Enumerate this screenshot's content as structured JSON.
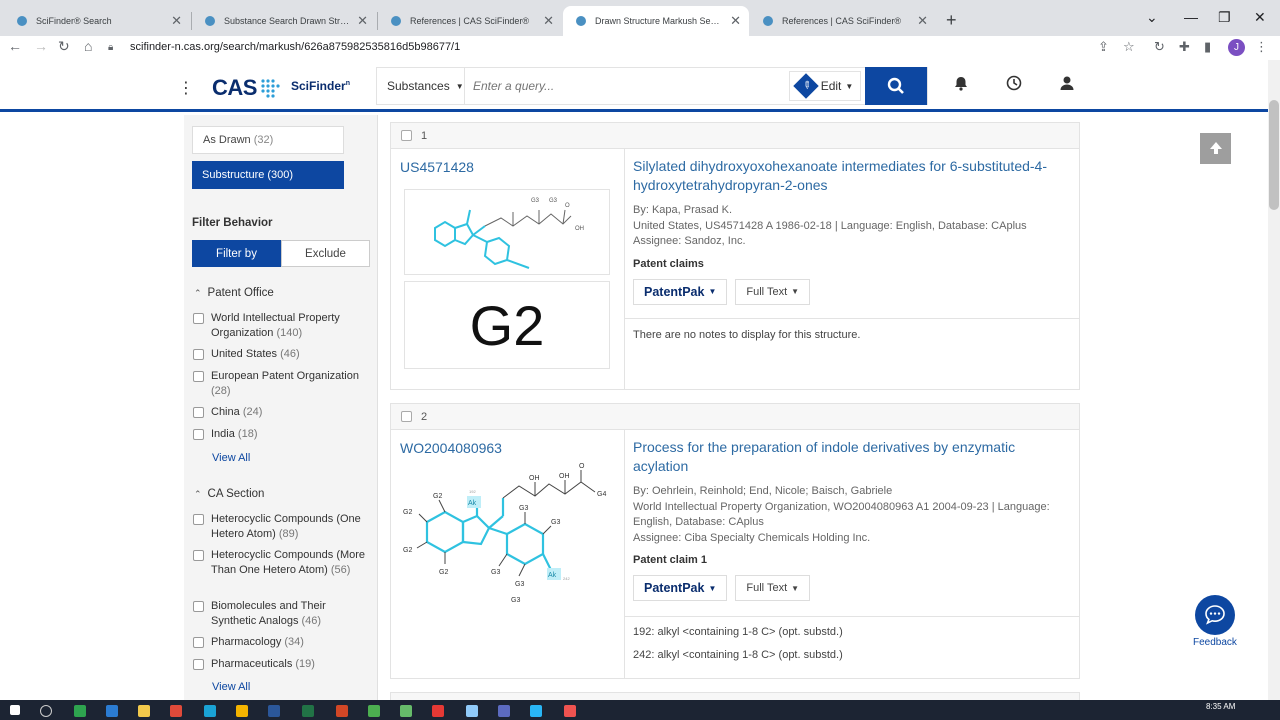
{
  "browser": {
    "tabs": [
      {
        "title": "SciFinder® Search",
        "active": false
      },
      {
        "title": "Substance Search Drawn Structure | CAS",
        "active": false
      },
      {
        "title": "References | CAS SciFinder®",
        "active": false
      },
      {
        "title": "Drawn Structure Markush Search | CAS",
        "active": true
      },
      {
        "title": "References | CAS SciFinder®",
        "active": false
      }
    ],
    "url": "scifinder-n.cas.org/search/markush/626a875982535816d5b98677/1",
    "profile_initial": "J"
  },
  "header": {
    "logo_text": "CAS",
    "product": "SciFinder",
    "product_sup": "n",
    "search_type": "Substances",
    "search_placeholder": "Enter a query...",
    "edit_label": "Edit"
  },
  "sidebar": {
    "as_drawn": {
      "label": "As Drawn",
      "count": "(32)"
    },
    "substructure": {
      "label": "Substructure",
      "count": "(300)"
    },
    "filter_behavior_title": "Filter Behavior",
    "filter_by": "Filter by",
    "exclude": "Exclude",
    "groups": [
      {
        "title": "Patent Office",
        "options": [
          {
            "label": "World Intellectual Property Organization",
            "count": "(140)"
          },
          {
            "label": "United States",
            "count": "(46)"
          },
          {
            "label": "European Patent Organization",
            "count": "(28)"
          },
          {
            "label": "China",
            "count": "(24)"
          },
          {
            "label": "India",
            "count": "(18)"
          }
        ],
        "view_all": "View All"
      },
      {
        "title": "CA Section",
        "options": [
          {
            "label": "Heterocyclic Compounds (One Hetero Atom)",
            "count": "(89)"
          },
          {
            "label": "Heterocyclic Compounds (More Than One Hetero Atom)",
            "count": "(56)"
          },
          {
            "label": "Biomolecules and Their Synthetic Analogs",
            "count": "(46)"
          },
          {
            "label": "Pharmacology",
            "count": "(34)"
          },
          {
            "label": "Pharmaceuticals",
            "count": "(19)"
          }
        ],
        "view_all": "View All"
      }
    ]
  },
  "results": [
    {
      "index": "1",
      "patent_number": "US4571428",
      "structure_label": "G2",
      "title": "Silylated dihydroxyoxohexanoate intermediates for 6-substituted-4-hydroxytetrahydropyran-2-ones",
      "authors": "By: Kapa, Prasad K.",
      "source": "United States, US4571428 A 1986-02-18 | Language: English, Database: CAplus",
      "assignee": "Assignee: Sandoz, Inc.",
      "claims_label": "Patent claims",
      "patentpak": "PatentPak",
      "fulltext": "Full Text",
      "notes": [
        "There are no notes to display for this structure."
      ],
      "struct_labels": [
        "G3",
        "G3",
        "OH",
        "O"
      ]
    },
    {
      "index": "2",
      "patent_number": "WO2004080963",
      "title": "Process for the preparation of indole derivatives by enzymatic acylation",
      "authors": "By: Oehrlein, Reinhold; End, Nicole; Baisch, Gabriele",
      "source": "World Intellectual Property Organization, WO2004080963 A1 2004-09-23 | Language: English, Database: CAplus",
      "assignee": "Assignee: Ciba Specialty Chemicals Holding Inc.",
      "claims_label": "Patent claim 1",
      "patentpak": "PatentPak",
      "fulltext": "Full Text",
      "notes": [
        "192: alkyl <containing 1-8 C> (opt. substd.)",
        "242: alkyl <containing 1-8 C> (opt. substd.)"
      ],
      "struct_labels": [
        "OH",
        "OH",
        "O",
        "G4",
        "G2",
        "G2",
        "G2",
        "G2",
        "Ak",
        "192",
        "G3",
        "G3",
        "G3",
        "G3",
        "Ak",
        "242",
        "G3"
      ]
    }
  ],
  "feedback_label": "Feedback",
  "taskbar_time": "8:35 AM",
  "colors": {
    "brand": "#0d47a1",
    "link": "#2d6aa3",
    "structure": "#2fc2e0"
  }
}
